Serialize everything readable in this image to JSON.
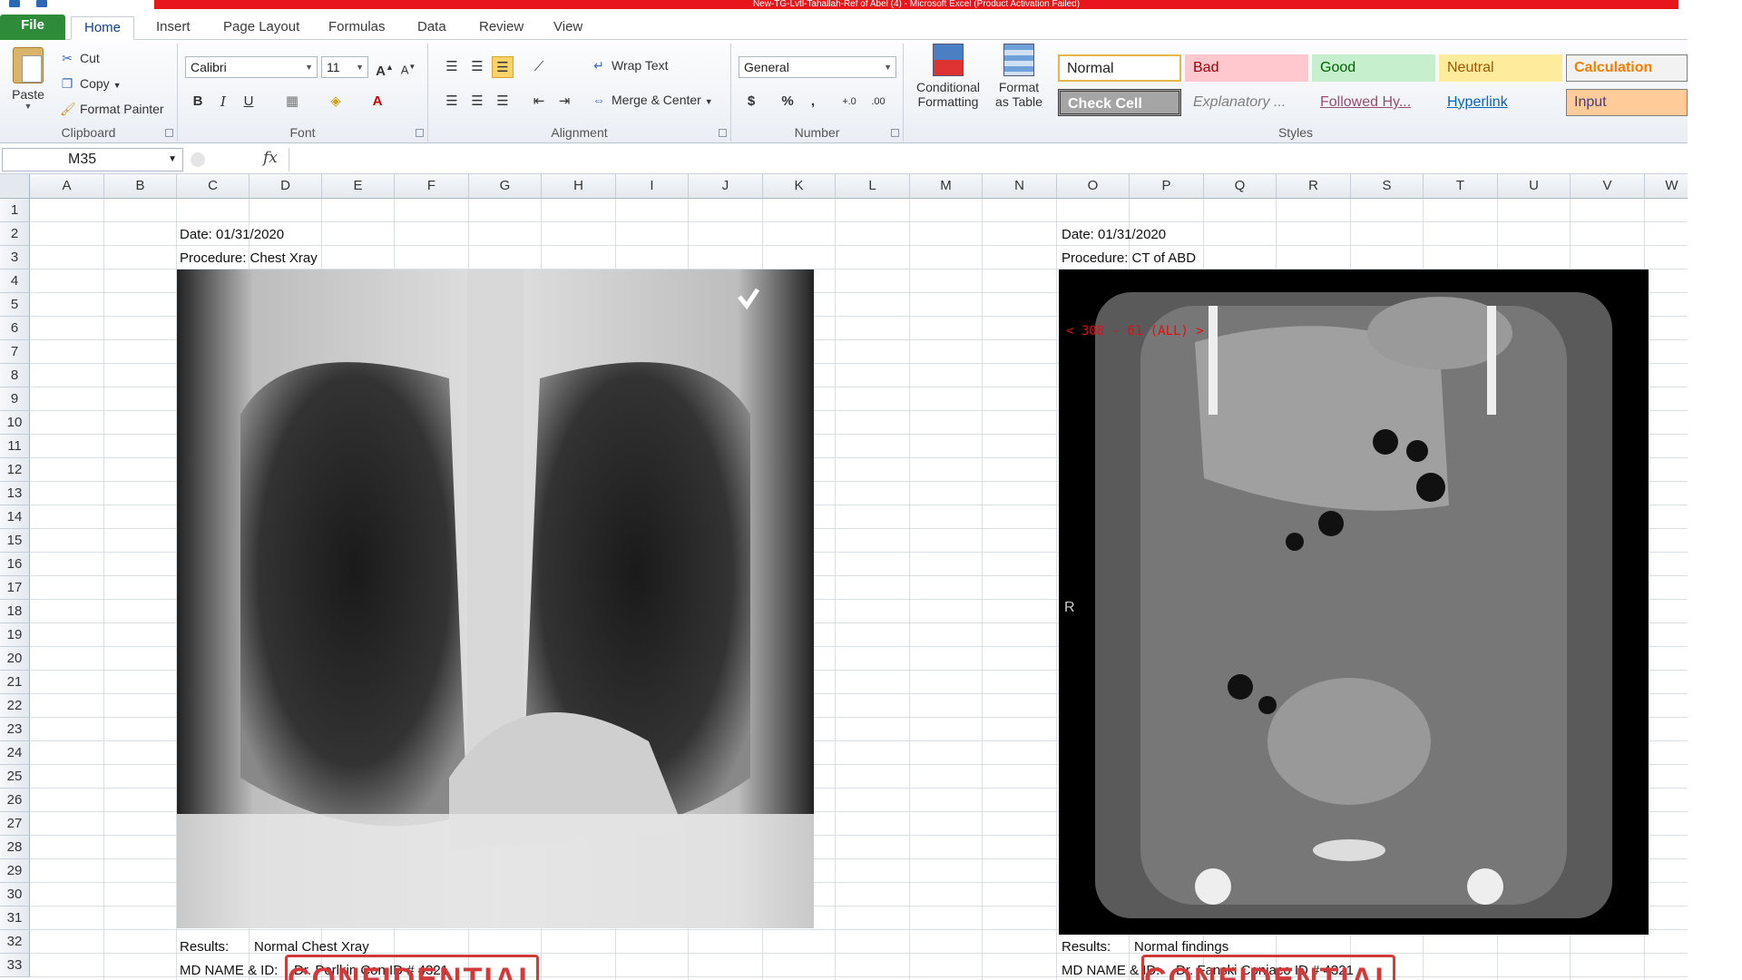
{
  "window": {
    "title": "New-TG-Lvtl-Tahallah-Ref of Abel (4) - Microsoft Excel (Product Activation Failed)"
  },
  "tabs": [
    "File",
    "Home",
    "Insert",
    "Page Layout",
    "Formulas",
    "Data",
    "Review",
    "View"
  ],
  "clipboard": {
    "paste": "Paste",
    "cut": "Cut",
    "copy": "Copy",
    "format_painter": "Format Painter",
    "label": "Clipboard"
  },
  "font": {
    "name": "Calibri",
    "size": "11",
    "bold": "B",
    "italic": "I",
    "underline": "U",
    "label": "Font"
  },
  "alignment": {
    "wrap_text": "Wrap Text",
    "merge_center": "Merge & Center",
    "label": "Alignment"
  },
  "number": {
    "format": "General",
    "currency": "$",
    "percent": "%",
    "comma": ",",
    "inc_decimal": "+.0",
    "dec_decimal": ".00",
    "label": "Number"
  },
  "styles_group": {
    "conditional_formatting": [
      "Conditional",
      "Formatting"
    ],
    "format_as_table": [
      "Format",
      "as Table"
    ],
    "label": "Styles",
    "cells": {
      "normal": "Normal",
      "bad": "Bad",
      "good": "Good",
      "neutral": "Neutral",
      "calculation": "Calculation",
      "check_cell": "Check Cell",
      "explanatory": "Explanatory ...",
      "followed_hy": "Followed Hy...",
      "hyperlink": "Hyperlink",
      "input": "Input"
    },
    "colors": {
      "bad_bg": "#ffc7ce",
      "bad_fg": "#9c0006",
      "good_bg": "#c6efce",
      "good_fg": "#006100",
      "neutral_bg": "#ffeb9c",
      "neutral_fg": "#9c5700",
      "calc_bg": "#f2f2f2",
      "calc_fg": "#fa7d00",
      "input_bg": "#ffcc99",
      "input_fg": "#3f3f76",
      "check_bg": "#a5a5a5"
    }
  },
  "formula_bar": {
    "name_box": "M35",
    "fx": "fx",
    "formula": ""
  },
  "columns": [
    "A",
    "B",
    "C",
    "D",
    "E",
    "F",
    "G",
    "H",
    "I",
    "J",
    "K",
    "L",
    "M",
    "N",
    "O",
    "P",
    "Q",
    "R",
    "S",
    "T",
    "U",
    "V",
    "W"
  ],
  "rows": [
    "1",
    "2",
    "3",
    "4",
    "5",
    "6",
    "7",
    "8",
    "9",
    "10",
    "11",
    "12",
    "13",
    "14",
    "15",
    "16",
    "17",
    "18",
    "19",
    "20",
    "21",
    "22",
    "23",
    "24",
    "25",
    "26",
    "27",
    "28",
    "29",
    "30",
    "31",
    "32",
    "33"
  ],
  "left_record": {
    "date": "Date: 01/31/2020",
    "procedure": "Procedure: Chest Xray",
    "results_label": "Results:",
    "results_value": "Normal Chest Xray",
    "md_label": "MD NAME & ID:",
    "md_value": "Dr. Perlkin Con ID # 4321",
    "stamp": "CONFIDENTIAL"
  },
  "right_record": {
    "date": "Date: 01/31/2020",
    "procedure": "Procedure: CT of ABD",
    "results_label": "Results:",
    "results_value": "Normal findings",
    "md_label": "MD NAME & ID:",
    "md_value": "Dr. Fanski Coniaco ID # 4321",
    "stamp": "CONFIDENTIAL",
    "ct_overlay": "< 308 - 61 (ALL) >",
    "ct_side": "R"
  }
}
